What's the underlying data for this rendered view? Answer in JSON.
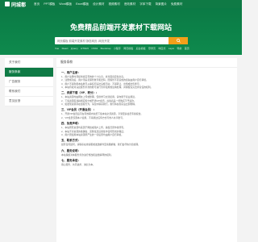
{
  "brand": {
    "name": "同城都",
    "logo_icon": "logo-mark-icon"
  },
  "topnav": [
    "首页",
    "PPT模板",
    "Word模板",
    "Excel模板",
    "设计素材",
    "视频素材",
    "音效素材",
    "字体下载",
    "背景图片",
    "免费素材"
  ],
  "hero": {
    "title": "免费精品前端开发素材下载网站",
    "search_placeholder": "网页模板 前端开发素材 静态网页 -网页开发",
    "search_icon": "search-icon",
    "hotwords": [
      "Vue",
      "React",
      "jQuery",
      "HTML5",
      "CSS3",
      "Bootstrap",
      "小程序",
      "网页模板",
      "后台模板",
      "登录页",
      "响应式",
      "Layui",
      "导航",
      "首页"
    ]
  },
  "sidebar": {
    "items": [
      {
        "label": "关于我们"
      },
      {
        "label": "服务条款"
      },
      {
        "label": "广告服务"
      },
      {
        "label": "联系我们"
      },
      {
        "label": "意见反馈"
      }
    ]
  },
  "main": {
    "heading": "服务条款",
    "sections": [
      {
        "title": "一、用户注册：",
        "lines": [
          "1、用户注册时须提供真实有效的个人信息，并对其真实性负责。",
          "2、注册成功后，用户须妥善保管账号和密码，因保管不善造成的损失由用户自行承担。",
          "3、用户不得利用本站账号从事任何违法违规活动，不得转让、出借或出售账号。",
          "4、本站有权对违反服务条款的账号进行暂停使用或注销处理，并保留追究法律责任的权利。"
        ]
      },
      {
        "title": "二、资源下载（VIP、积分）：",
        "lines": [
          "1、本站资源均由网友上传或整理，仅供学习交流使用，请勿用于商业用途。",
          "2、下载资源需消耗相应积分或开通VIP会员，虚拟商品一经购买不予退款。",
          "3、如发现资源存在侵权行为，请及时联系我们，我们将在核实后立即删除。"
        ]
      },
      {
        "title": "三、VIP会员（开通会员）：",
        "lines": [
          "1、开通VIP会员后可在有效期内免费下载本站全部资源，享受更多会员专属权益。",
          "2、VIP会员仅限本人使用，不得通过任何方式与他人共享账号。"
        ]
      },
      {
        "title": "四、免责声明：",
        "lines": [
          "1、本站所有资源均来源于网络或用户上传，版权归原作者所有。",
          "2、本站不对资源的准确性、完整性及适用性作任何形式的保证。",
          "3、用户因使用本站资源所产生的一切后果均由用户自行承担。"
        ]
      },
      {
        "title": "五、联系方式：",
        "lines": [
          "如有任何疑问，请联系在线客服或发送邮件至客服邮箱，我们会尽快为您处理。"
        ]
      },
      {
        "title": "六、服务说明：",
        "lines": [
          "本站保留对本服务条款进行修改和最终解释的权利。"
        ]
      },
      {
        "title": "七、服务承诺：",
        "lines": [
          "用心服务，共同进步，诚信为本。"
        ]
      }
    ]
  },
  "colors": {
    "primary": "#0f7a45",
    "accent": "#f2a01a"
  }
}
